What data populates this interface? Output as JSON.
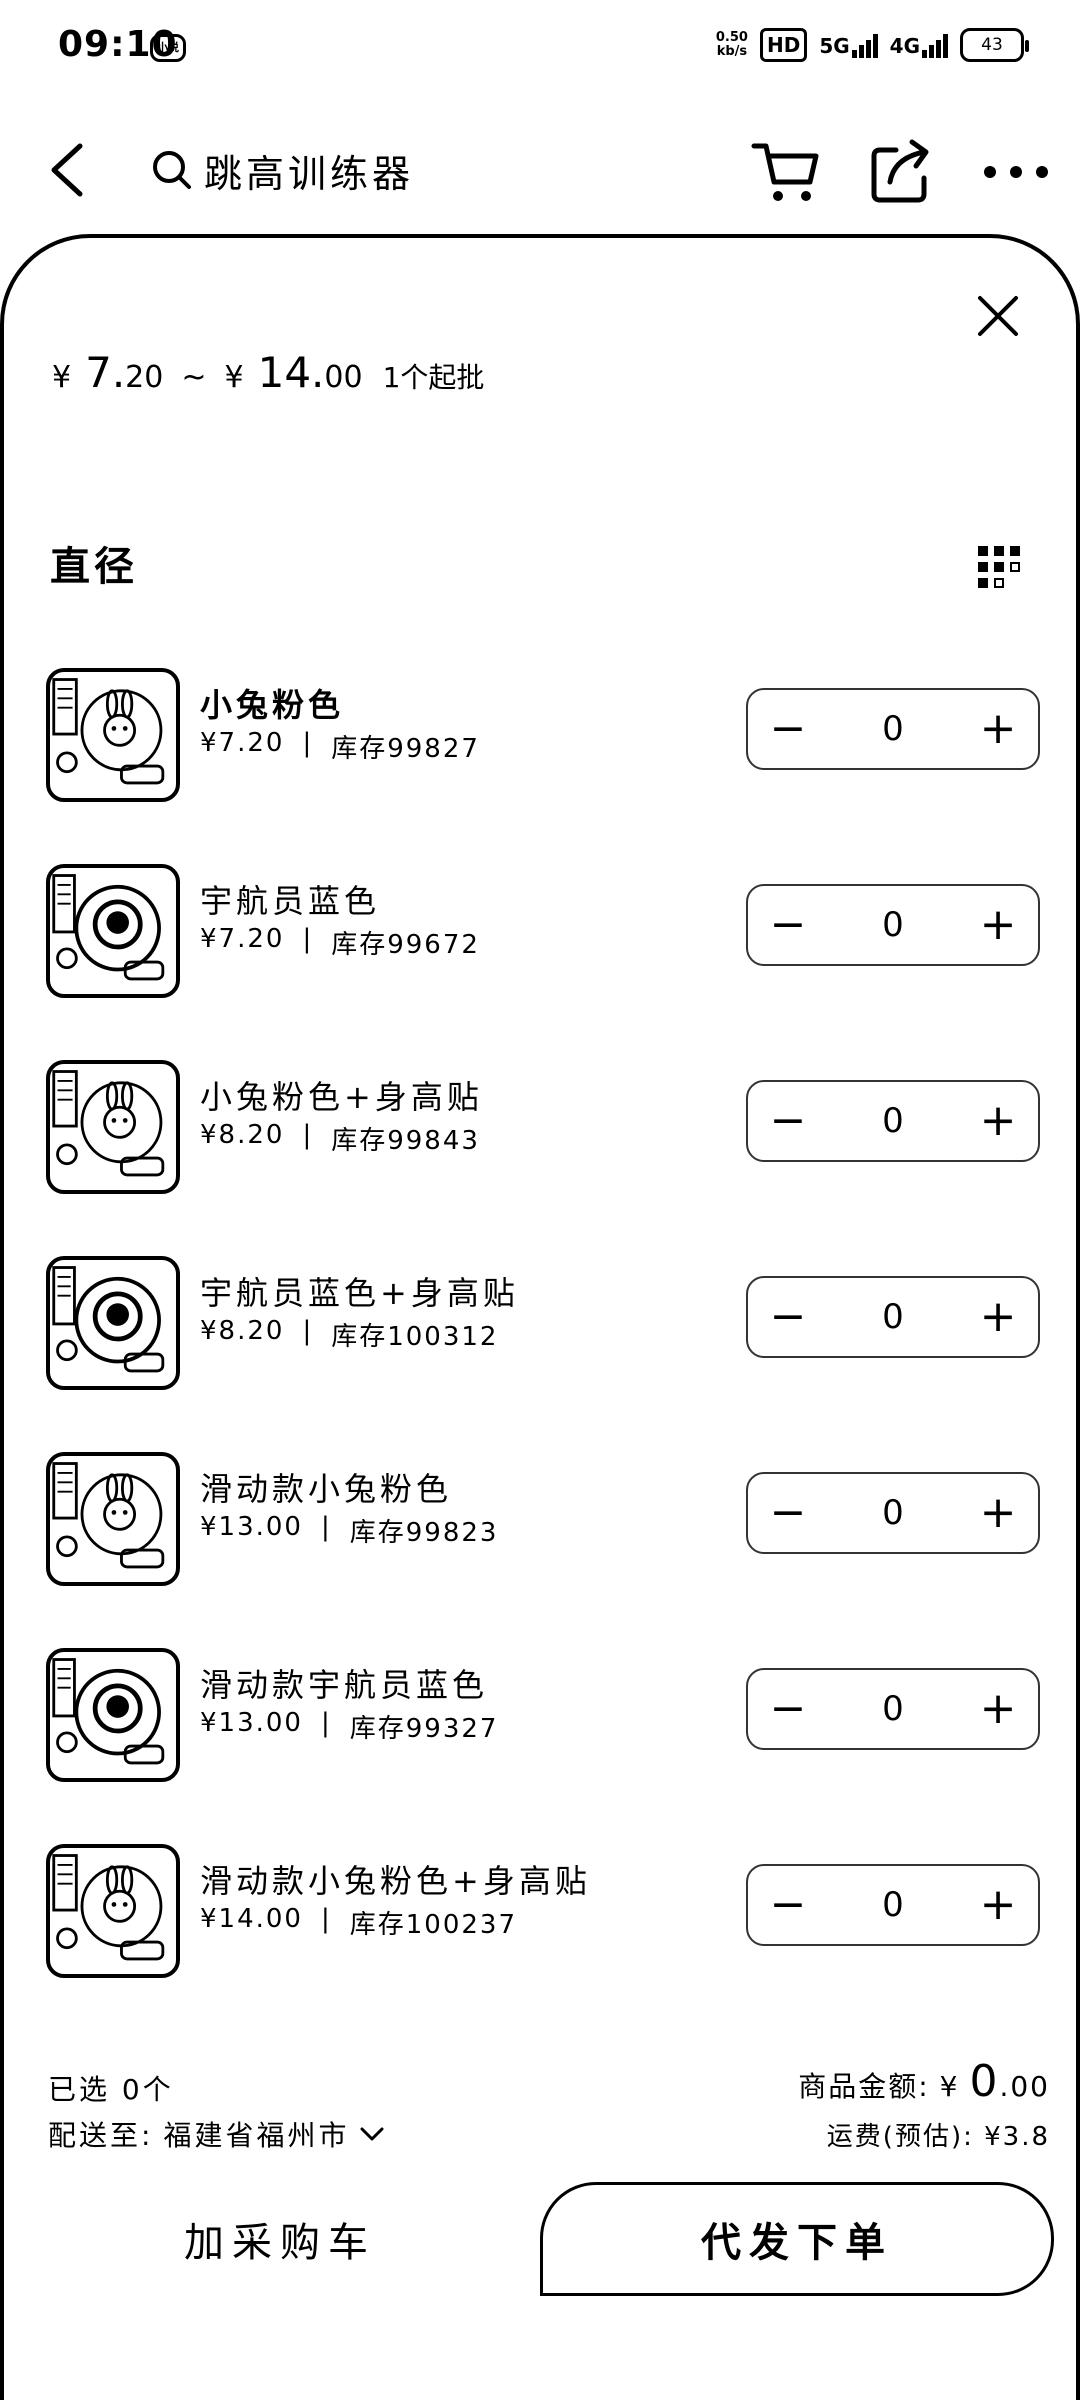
{
  "status_bar": {
    "time": "09:10",
    "left_badge": "小说",
    "speed_top": "0.50",
    "speed_bottom": "kb/s",
    "hd": "HD",
    "net1": "5G",
    "net2": "4G",
    "battery": "43"
  },
  "topbar": {
    "search_text": "跳高训练器"
  },
  "sheet": {
    "price": {
      "yen": "¥",
      "low_int": "7.",
      "low_dec": "20",
      "sep": "~",
      "high_int": "14.",
      "high_dec": "00",
      "min_order": "1个起批"
    },
    "spec_title": "直径",
    "items": [
      {
        "name": "小兔粉色",
        "price": "¥7.20",
        "divider": "|",
        "stock": "库存99827",
        "qty": "0",
        "img": "bunny"
      },
      {
        "name": "宇航员蓝色",
        "price": "¥7.20",
        "divider": "|",
        "stock": "库存99672",
        "qty": "0",
        "img": "astronaut"
      },
      {
        "name": "小兔粉色+身高贴",
        "price": "¥8.20",
        "divider": "|",
        "stock": "库存99843",
        "qty": "0",
        "img": "bunny"
      },
      {
        "name": "宇航员蓝色+身高贴",
        "price": "¥8.20",
        "divider": "|",
        "stock": "库存100312",
        "qty": "0",
        "img": "astronaut"
      },
      {
        "name": "滑动款小兔粉色",
        "price": "¥13.00",
        "divider": "|",
        "stock": "库存99823",
        "qty": "0",
        "img": "bunny"
      },
      {
        "name": "滑动款宇航员蓝色",
        "price": "¥13.00",
        "divider": "|",
        "stock": "库存99327",
        "qty": "0",
        "img": "astronaut"
      },
      {
        "name": "滑动款小兔粉色+身高贴",
        "price": "¥14.00",
        "divider": "|",
        "stock": "库存100237",
        "qty": "0",
        "img": "bunny"
      }
    ],
    "minus": "−",
    "plus": "+"
  },
  "footer": {
    "selected": "已选 0个",
    "ship_label": "配送至:",
    "ship_city": "福建省福州市",
    "amount_label": "商品金额:",
    "amount_yen": "¥",
    "amount_int": "0",
    "amount_dec": ".00",
    "freight": "运费(预估): ¥3.8",
    "add_cart": "加采购车",
    "place_order": "代发下单"
  }
}
